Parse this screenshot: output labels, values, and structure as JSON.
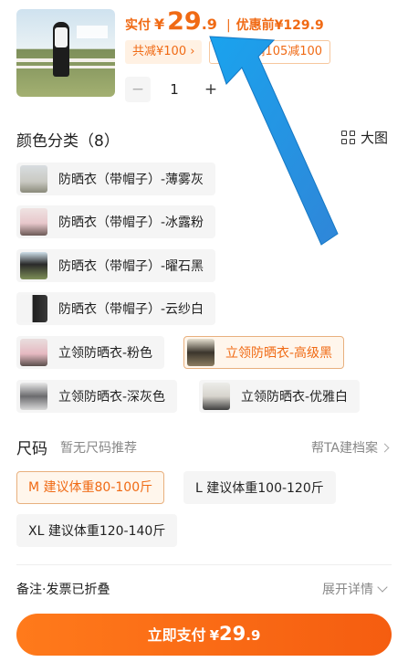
{
  "product": {
    "price_label": "实付",
    "currency": "¥",
    "price_int": "29",
    "price_dec": ".9",
    "original_price": "优惠前¥129.9",
    "discount_tag": "共减¥100 ›",
    "coupon_tag": "商品券满105减100",
    "quantity": "1",
    "minus": "−",
    "plus": "+"
  },
  "color_section": {
    "title": "颜色分类（8）",
    "big_view_label": "大图",
    "options": [
      {
        "label": "防晒衣（带帽子）-薄雾灰",
        "selected": false
      },
      {
        "label": "防晒衣（带帽子）-冰露粉",
        "selected": false
      },
      {
        "label": "防晒衣（带帽子）-曜石黑",
        "selected": false
      },
      {
        "label": "防晒衣（带帽子）-云纱白",
        "selected": false
      },
      {
        "label": "立领防晒衣-粉色",
        "selected": false
      },
      {
        "label": "立领防晒衣-高级黑",
        "selected": true
      },
      {
        "label": "立领防晒衣-深灰色",
        "selected": false
      },
      {
        "label": "立领防晒衣-优雅白",
        "selected": false
      }
    ]
  },
  "size_section": {
    "title": "尺码",
    "hint": "暂无尺码推荐",
    "archive_link": "帮TA建档案",
    "options": [
      {
        "label": "M 建议体重80-100斤",
        "selected": true
      },
      {
        "label": "L 建议体重100-120斤",
        "selected": false
      },
      {
        "label": "XL 建议体重120-140斤",
        "selected": false
      }
    ]
  },
  "remark": {
    "label": "备注·发票已折叠",
    "expand": "展开详情"
  },
  "pay_button": {
    "label": "立即支付",
    "currency": "¥",
    "amount_int": "29",
    "amount_dec": ".9"
  },
  "colors": {
    "accent": "#f06a14",
    "arrow": "#1e9be8"
  }
}
